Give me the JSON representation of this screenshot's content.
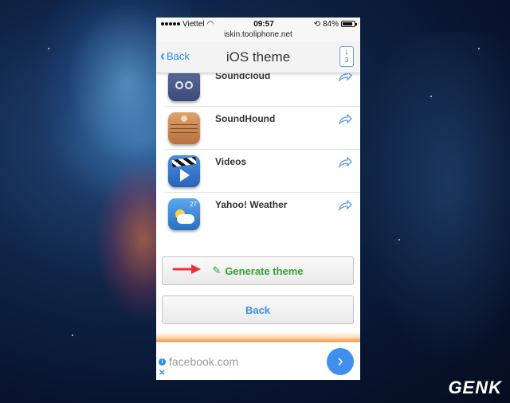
{
  "status_bar": {
    "carrier": "Viettel",
    "time": "09:57",
    "battery": "84%"
  },
  "url": "iskin.tooliphone.net",
  "nav": {
    "back_label": "Back",
    "title": "iOS theme",
    "download_count": "3"
  },
  "apps": [
    {
      "name": "Soundcloud",
      "icon": "soundcloud-icon"
    },
    {
      "name": "SoundHound",
      "icon": "soundhound-icon"
    },
    {
      "name": "Videos",
      "icon": "videos-icon"
    },
    {
      "name": "Yahoo! Weather",
      "icon": "yahoo-weather-icon",
      "badge": "27"
    }
  ],
  "buttons": {
    "generate": "Generate theme",
    "back": "Back"
  },
  "ad": {
    "text": "facebook.com",
    "info": "i",
    "close": "✕"
  },
  "watermark": "GENK",
  "colors": {
    "accent": "#2d8cf0",
    "generate_green": "#37a032",
    "ribbon_orange": "#f59342",
    "arrow_red": "#e8323a"
  }
}
